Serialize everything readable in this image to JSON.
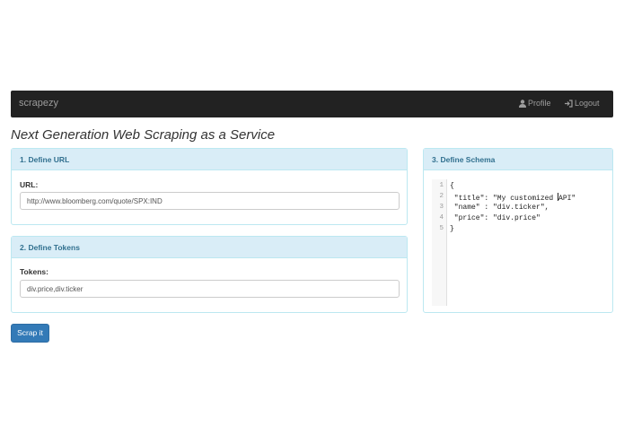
{
  "navbar": {
    "brand": "scrapezy",
    "profile_label": "Profile",
    "logout_label": "Logout",
    "profile_icon": "user-icon",
    "logout_icon": "sign-in-icon"
  },
  "page_title": "Next Generation Web Scraping as a Service",
  "url_panel": {
    "heading": "1. Define URL",
    "label": "URL:",
    "value": "http://www.bloomberg.com/quote/SPX:IND"
  },
  "tokens_panel": {
    "heading": "2. Define Tokens",
    "label": "Tokens:",
    "value": "div.price,div.ticker"
  },
  "schema_panel": {
    "heading": "3. Define Schema",
    "line_numbers": [
      "1",
      "2",
      "3",
      "4",
      "5"
    ],
    "lines": [
      "{",
      " \"title\": \"My customized ",
      " \"name\" : \"div.ticker\",",
      " \"price\": \"div.price\"",
      "}"
    ],
    "line2_after_cursor": "API\""
  },
  "submit_label": "Scrap it",
  "colors": {
    "navbar": "#222222",
    "panel_heading": "#d9edf7",
    "panel_border": "#bce8f1",
    "primary": "#337ab7"
  }
}
